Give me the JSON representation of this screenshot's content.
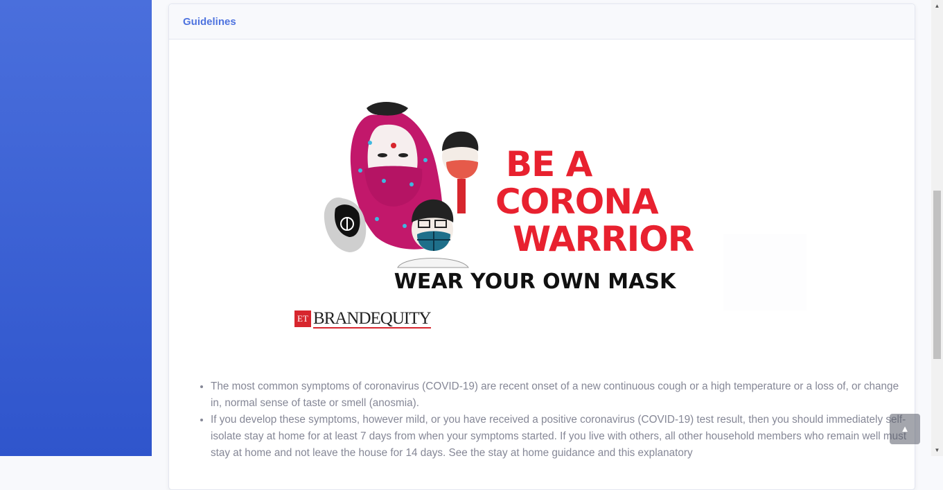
{
  "card": {
    "title": "Guidelines"
  },
  "banner": {
    "headline_line1": "BE A",
    "headline_line2": "CORONA",
    "headline_line3": "WARRIOR",
    "tagline": "WEAR YOUR OWN MASK",
    "logo_badge": "ET",
    "logo_name": "BRANDEQUITY"
  },
  "guidelines": [
    "The most common symptoms of coronavirus (COVID-19) are recent onset of a new continuous cough or a high temperature or a loss of, or change in, normal sense of taste or smell (anosmia).",
    "If you develop these symptoms, however mild, or you have received a positive coronavirus (COVID-19) test result, then you should immediately self-isolate stay at home for at least 7 days from when your symptoms started. If you live with others, all other household members who remain well must stay at home and not leave the house for 14 days. See the stay at home guidance and this explanatory"
  ],
  "colors": {
    "sidebar_top": "#4a6fdc",
    "sidebar_bottom": "#2f55cc",
    "accent": "#4e73df",
    "headline_red": "#e8212f",
    "body_text": "#858796"
  },
  "icons": {
    "back_to_top": "chevron-up-icon",
    "scroll_up": "scroll-up-arrow-icon",
    "scroll_down": "scroll-down-arrow-icon"
  }
}
